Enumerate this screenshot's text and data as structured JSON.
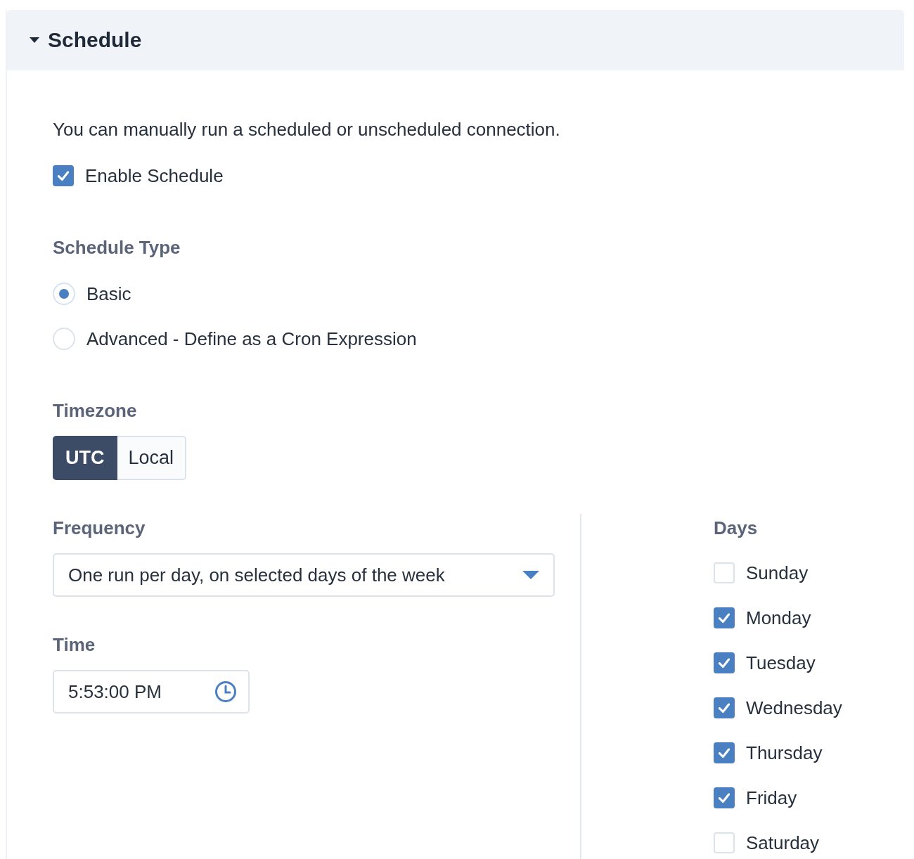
{
  "section": {
    "title": "Schedule",
    "expanded": true
  },
  "description": "You can manually run a scheduled or unscheduled connection.",
  "enable": {
    "label": "Enable Schedule",
    "checked": true
  },
  "schedule_type": {
    "label": "Schedule Type",
    "options": [
      {
        "label": "Basic",
        "selected": true
      },
      {
        "label": "Advanced - Define as a Cron Expression",
        "selected": false
      }
    ]
  },
  "timezone": {
    "label": "Timezone",
    "options": [
      {
        "label": "UTC",
        "selected": true
      },
      {
        "label": "Local",
        "selected": false
      }
    ]
  },
  "frequency": {
    "label": "Frequency",
    "value": "One run per day, on selected days of the week"
  },
  "time": {
    "label": "Time",
    "value": "5:53:00 PM"
  },
  "days": {
    "label": "Days",
    "items": [
      {
        "label": "Sunday",
        "checked": false
      },
      {
        "label": "Monday",
        "checked": true
      },
      {
        "label": "Tuesday",
        "checked": true
      },
      {
        "label": "Wednesday",
        "checked": true
      },
      {
        "label": "Thursday",
        "checked": true
      },
      {
        "label": "Friday",
        "checked": true
      },
      {
        "label": "Saturday",
        "checked": false
      }
    ]
  }
}
